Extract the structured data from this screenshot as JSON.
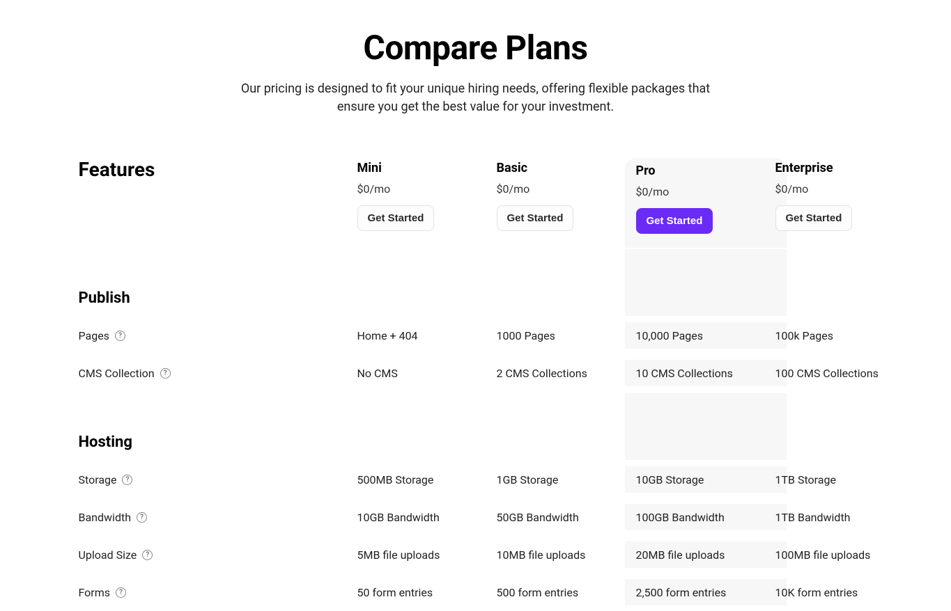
{
  "header": {
    "title": "Compare Plans",
    "subtitle": "Our pricing is designed to fit your unique hiring needs, offering flexible packages that ensure you get the best value for your investment."
  },
  "features_label": "Features",
  "plans": [
    {
      "name": "Mini",
      "price": "$0/mo",
      "cta": "Get Started",
      "highlight": false
    },
    {
      "name": "Basic",
      "price": "$0/mo",
      "cta": "Get Started",
      "highlight": false
    },
    {
      "name": "Pro",
      "price": "$0/mo",
      "cta": "Get Started",
      "highlight": true
    },
    {
      "name": "Enterprise",
      "price": "$0/mo",
      "cta": "Get Started",
      "highlight": false
    }
  ],
  "sections": [
    {
      "heading": "Publish",
      "rows": [
        {
          "label": "Pages",
          "values": [
            "Home + 404",
            "1000 Pages",
            "10,000 Pages",
            "100k Pages"
          ]
        },
        {
          "label": "CMS Collection",
          "values": [
            "No CMS",
            "2 CMS Collections",
            "10 CMS Collections",
            "100 CMS Collections"
          ]
        }
      ]
    },
    {
      "heading": "Hosting",
      "rows": [
        {
          "label": "Storage",
          "values": [
            "500MB Storage",
            "1GB Storage",
            "10GB Storage",
            "1TB Storage"
          ]
        },
        {
          "label": "Bandwidth",
          "values": [
            "10GB Bandwidth",
            "50GB Bandwidth",
            "100GB Bandwidth",
            "1TB Bandwidth"
          ]
        },
        {
          "label": "Upload Size",
          "values": [
            "5MB file uploads",
            "10MB file uploads",
            "20MB file uploads",
            "100MB file uploads"
          ]
        },
        {
          "label": "Forms",
          "values": [
            "50 form entries",
            "500 form entries",
            "2,500 form entries",
            "10K form entries"
          ]
        }
      ]
    }
  ]
}
